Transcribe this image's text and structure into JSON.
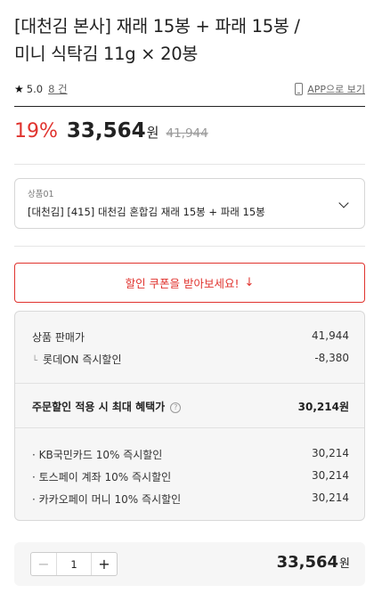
{
  "product": {
    "title_line1": "[대천김 본사] 재래 15봉 + 파래 15봉 /",
    "title_line2": "미니 식탁김 11g × 20봉"
  },
  "rating": {
    "score": "5.0",
    "review_count": "8 건",
    "app_link": "APP으로 보기"
  },
  "price": {
    "discount_rate": "19%",
    "sale_price": "33,564",
    "currency": "원",
    "original_price": "41,944"
  },
  "option": {
    "label": "상품01",
    "value": "[대천김] [415] 대천김 혼합김 재래 15봉 + 파래 15봉"
  },
  "coupon": {
    "label": "할인 쿠폰을 받아보세요!"
  },
  "benefits": {
    "sale_price_label": "상품 판매가",
    "sale_price_value": "41,944",
    "discount_label": "롯데ON 즉시할인",
    "discount_value": "-8,380",
    "max_benefit_label": "주문할인 적용 시 최대 혜택가",
    "max_benefit_value": "30,214원",
    "card_offers": [
      {
        "label": "· KB국민카드 10% 즉시할인",
        "value": "30,214"
      },
      {
        "label": "· 토스페이 계좌 10% 즉시할인",
        "value": "30,214"
      },
      {
        "label": "· 카카오페이 머니 10% 즉시할인",
        "value": "30,214"
      }
    ]
  },
  "order": {
    "quantity": "1",
    "minus": "−",
    "plus": "+",
    "total_price": "33,564",
    "currency": "원"
  },
  "colors": {
    "accent_red": "#e0332e",
    "panel_gray": "#f6f6f6"
  }
}
